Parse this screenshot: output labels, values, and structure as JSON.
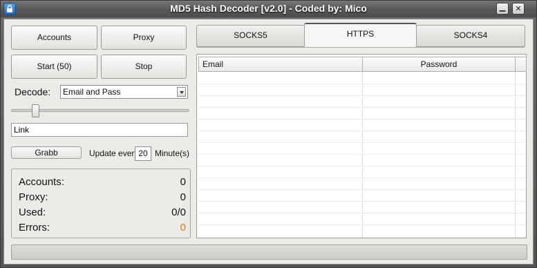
{
  "window": {
    "title": "MD5 Hash Decoder [v2.0] - Coded by: Mico",
    "minimize_glyph": "▁",
    "close_glyph": "✕"
  },
  "buttons": {
    "accounts": "Accounts",
    "proxy": "Proxy",
    "start": "Start (50)",
    "stop": "Stop",
    "grabb": "Grabb"
  },
  "decode": {
    "label": "Decode:",
    "selected": "Email and Pass"
  },
  "slider": {
    "value_fraction": 0.12
  },
  "link": {
    "value": "Link"
  },
  "update": {
    "label": "Update every",
    "value": "20",
    "unit": "Minute(s)"
  },
  "stats": {
    "accounts_label": "Accounts:",
    "accounts_value": "0",
    "proxy_label": "Proxy:",
    "proxy_value": "0",
    "used_label": "Used:",
    "used_value": "0/0",
    "errors_label": "Errors:",
    "errors_value": "0",
    "errors_color": "#e07a00"
  },
  "tabs": {
    "socks5": "SOCKS5",
    "https": "HTTPS",
    "socks4": "SOCKS4",
    "active": "HTTPS"
  },
  "grid": {
    "columns": [
      "Email",
      "Password"
    ]
  },
  "icons": {
    "title_icon": "lock-icon"
  }
}
